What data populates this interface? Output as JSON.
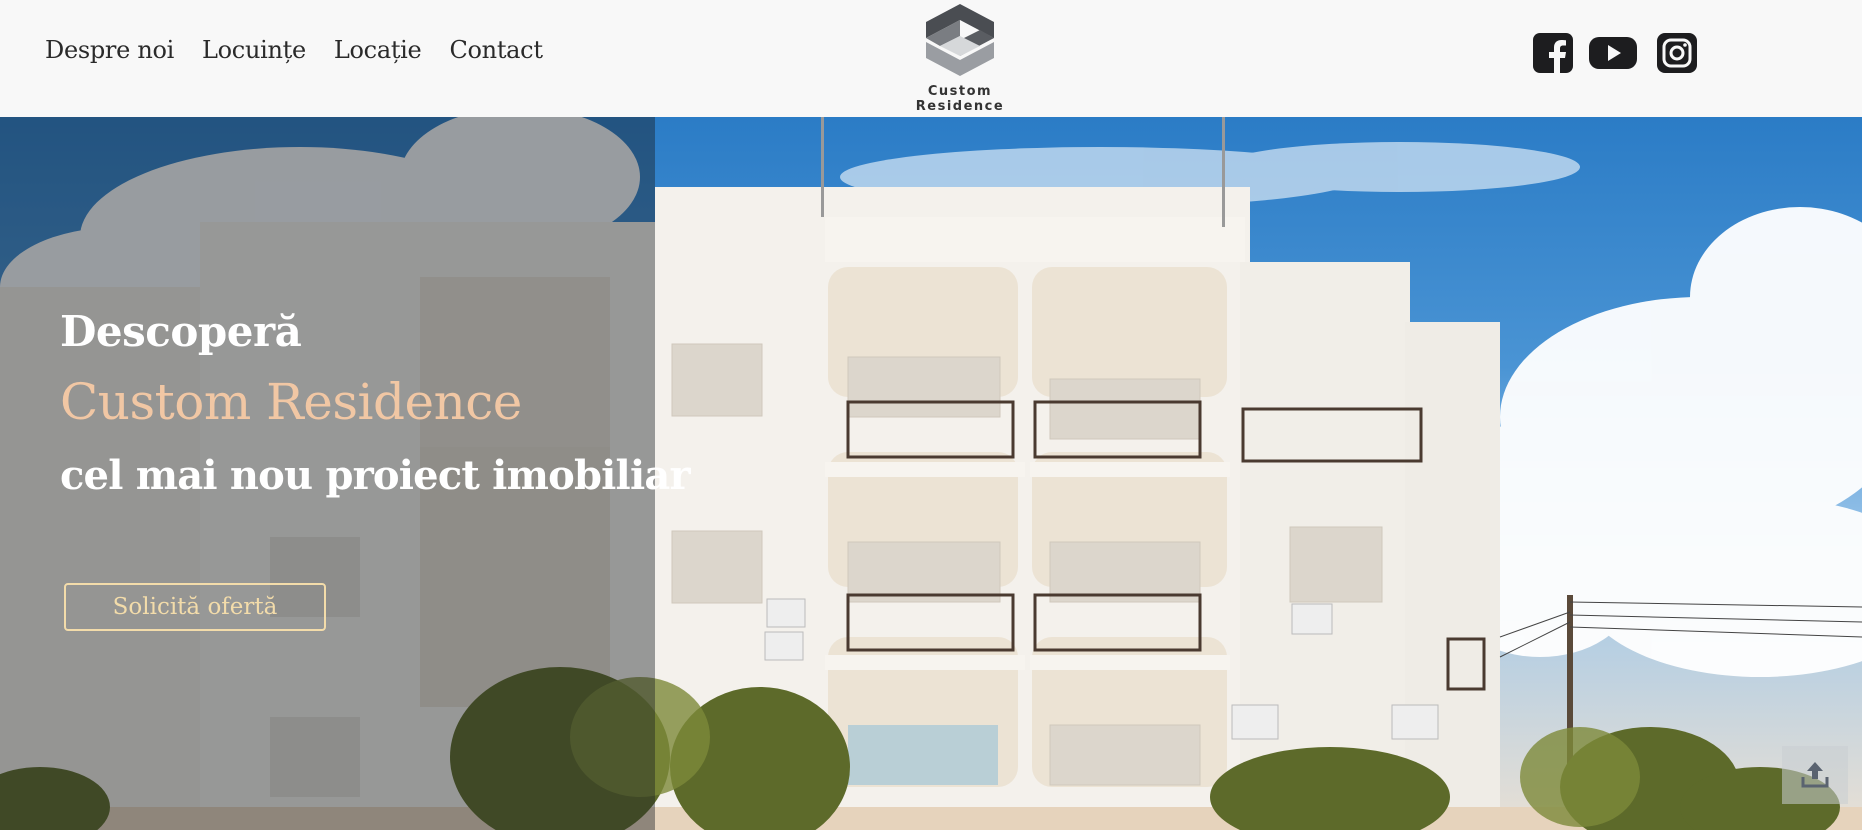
{
  "nav": {
    "items": [
      "Despre noi",
      "Locuințe",
      "Locație",
      "Contact"
    ]
  },
  "brand": {
    "name": "Custom Residence",
    "logo_icon": "geometric-cube-logo"
  },
  "social": {
    "icons": [
      "facebook-icon",
      "youtube-icon",
      "instagram-icon"
    ]
  },
  "hero": {
    "line1": "Descoperă",
    "line2": "Custom Residence",
    "line3": "cel mai nou proiect imobiliar",
    "cta_label": "Solicită ofertă",
    "scroll_icon": "upload-arrow-icon"
  },
  "colors": {
    "accent": "#f1c7a4",
    "cta_border": "#f3dcaa",
    "header_bg": "#f8f8f8",
    "text_dark": "#2a2a2a"
  }
}
